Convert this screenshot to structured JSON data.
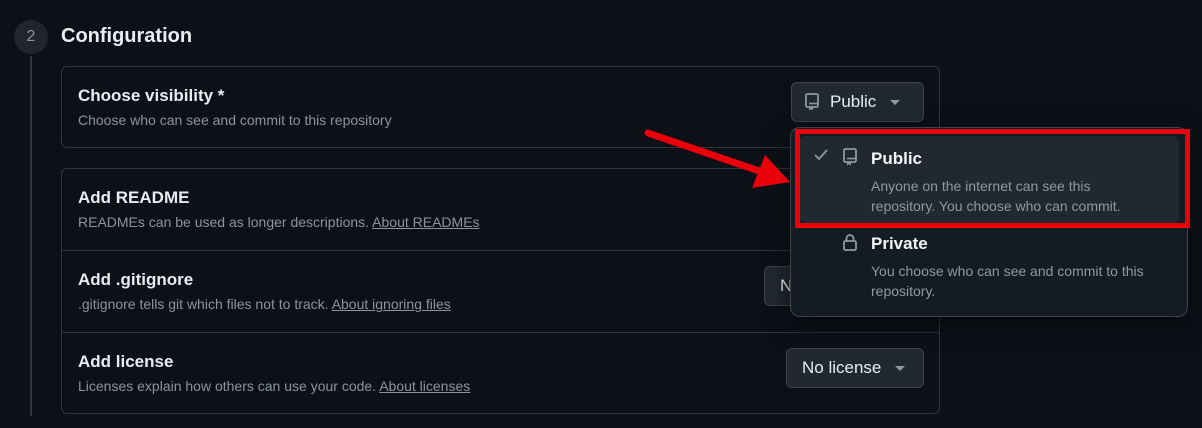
{
  "step": {
    "number": "2",
    "title": "Configuration"
  },
  "visibility": {
    "title": "Choose visibility *",
    "description": "Choose who can see and commit to this repository",
    "selected_label": "Public"
  },
  "readme": {
    "title": "Add README",
    "description": "READMEs can be used as longer descriptions.",
    "link": "About READMEs"
  },
  "gitignore": {
    "title": "Add .gitignore",
    "description": ".gitignore tells git which files not to track.",
    "link": "About ignoring files",
    "button_label_partial": "N"
  },
  "license": {
    "title": "Add license",
    "description": "Licenses explain how others can use your code.",
    "link": "About licenses",
    "button_label": "No license"
  },
  "dropdown": {
    "options": [
      {
        "label": "Public",
        "description_line1": "Anyone on the internet can see this",
        "description_line2": "repository. You choose who can commit.",
        "icon": "repo-icon",
        "selected": true
      },
      {
        "label": "Private",
        "description_line1": "You choose who can see and commit to this",
        "description_line2": "repository.",
        "icon": "lock-icon",
        "selected": false
      }
    ]
  },
  "colors": {
    "annotation_red": "#e8000b",
    "background": "#0d1117"
  }
}
